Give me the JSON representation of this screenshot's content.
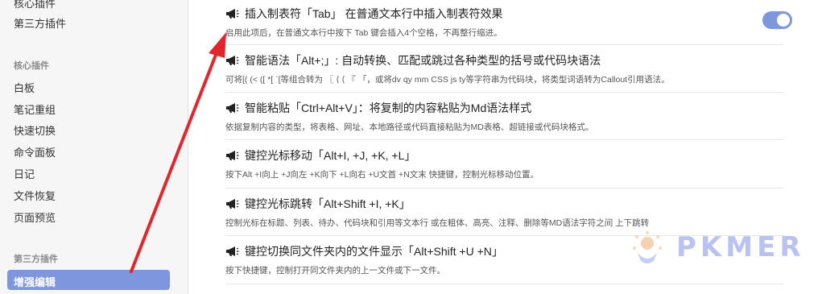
{
  "sidebar": {
    "top_items": [
      "核心插件",
      "第三方插件"
    ],
    "core_heading": "核心插件",
    "core_items": [
      "白板",
      "笔记重组",
      "快速切换",
      "命令面板",
      "日记",
      "文件恢复",
      "页面预览"
    ],
    "third_heading": "第三方插件",
    "active_item": "增强编辑"
  },
  "settings": [
    {
      "title": "插入制表符「Tab」 在普通文本行中插入制表符效果",
      "desc": "启用此项后，在普通文本行中按下 Tab 键会插入4个空格，不再整行缩进。",
      "toggle_on": true
    },
    {
      "title": "智能语法「Alt+;」: 自动转换、匹配或跳过各种类型的括号或代码块语法",
      "desc": "可将[( (< ([ *[ `[等组合转为 〖 ⟨ ⟨ 『 「，或将dv qy mm CSS js ty等字符串为代码块，将类型词语转为Callout引用语法。"
    },
    {
      "title": "智能粘贴「Ctrl+Alt+V」：将复制的内容粘贴为Md语法样式",
      "desc": "依据复制内容的类型，将表格、网址、本地路径或代码直接粘贴为MD表格、超链接或代码块格式。"
    },
    {
      "title": "键控光标移动「Alt+I, +J, +K, +L」",
      "desc": "按下Alt +I向上 +J向左 +K向下 +L向右 +U文首 +N文末 快捷键，控制光标移动位置。"
    },
    {
      "title": "键控光标跳转「Alt+Shift +I, +K」",
      "desc": "控制光标在标题、列表、待办、代码块和引用等文本行 或在粗体、高亮、注释、删除等MD语法字符之间 上下跳转"
    },
    {
      "title": "键控切换同文件夹内的文件显示「Alt+Shift +U +N」",
      "desc": "按下快捷键，控制打开同文件夹内的上一文件或下一文件。"
    }
  ],
  "watermark": "PKMER",
  "colors": {
    "accent": "#7d96de",
    "arrow": "#e2262b",
    "watermark": "#b9c2f0"
  }
}
